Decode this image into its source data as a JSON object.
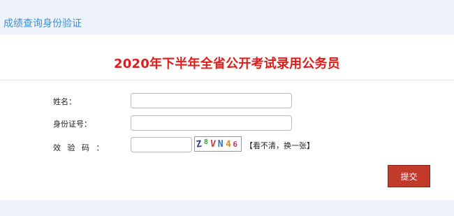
{
  "header": {
    "title": "成绩查询身份验证"
  },
  "form": {
    "heading": "2020年下半年全省公开考试录用公务员",
    "name_label": "姓名：",
    "name_value": "",
    "id_label": "身份证号：",
    "id_value": "",
    "code_label": "效 验 码 ：",
    "code_value": "",
    "captcha_chars": [
      "Z",
      "8",
      "V",
      "N",
      "4",
      "6"
    ],
    "refresh_label": "【看不清，换一张】",
    "submit_label": "提交"
  },
  "colors": {
    "accent": "#3f8ed6",
    "heading": "#e01b1b",
    "submit": "#c23a29",
    "background": "#eef3fb"
  }
}
